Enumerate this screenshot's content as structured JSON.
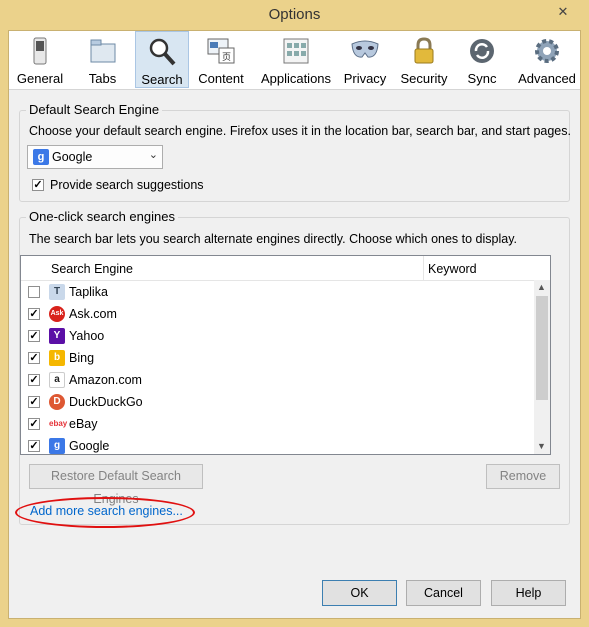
{
  "window": {
    "title": "Options",
    "close": "✕"
  },
  "toolbar": {
    "items": [
      {
        "label": "General",
        "icon": "general-switch-icon",
        "selected": false
      },
      {
        "label": "Tabs",
        "icon": "tabs-icon",
        "selected": false
      },
      {
        "label": "Search",
        "icon": "magnifier-icon",
        "selected": true
      },
      {
        "label": "Content",
        "icon": "content-icon",
        "selected": false
      },
      {
        "label": "Applications",
        "icon": "applications-icon",
        "selected": false
      },
      {
        "label": "Privacy",
        "icon": "mask-icon",
        "selected": false
      },
      {
        "label": "Security",
        "icon": "padlock-icon",
        "selected": false
      },
      {
        "label": "Sync",
        "icon": "sync-icon",
        "selected": false
      },
      {
        "label": "Advanced",
        "icon": "gear-icon",
        "selected": false
      }
    ]
  },
  "default_engine": {
    "legend": "Default Search Engine",
    "description": "Choose your default search engine. Firefox uses it in the location bar, search bar, and start pages.",
    "selected": "Google",
    "suggest_label": "Provide search suggestions",
    "suggest_checked": true
  },
  "one_click": {
    "legend": "One-click search engines",
    "description": "The search bar lets you search alternate engines directly. Choose which ones to display.",
    "columns": [
      "Search Engine",
      "Keyword"
    ],
    "engines": [
      {
        "name": "Taplika",
        "checked": false,
        "icon": "taplika-icon",
        "color": "#7fa3c9"
      },
      {
        "name": "Ask.com",
        "checked": true,
        "icon": "ask-icon",
        "color": "#d9231c"
      },
      {
        "name": "Yahoo",
        "checked": true,
        "icon": "yahoo-icon",
        "color": "#5b0fa6"
      },
      {
        "name": "Bing",
        "checked": true,
        "icon": "bing-icon",
        "color": "#f5b700"
      },
      {
        "name": "Amazon.com",
        "checked": true,
        "icon": "amazon-icon",
        "color": "#222222"
      },
      {
        "name": "DuckDuckGo",
        "checked": true,
        "icon": "duckduckgo-icon",
        "color": "#de5833"
      },
      {
        "name": "eBay",
        "checked": true,
        "icon": "ebay-icon",
        "color": "#e53238"
      },
      {
        "name": "Google",
        "checked": true,
        "icon": "google-icon",
        "color": "#3b78e7"
      }
    ],
    "restore_label": "Restore Default Search Engines",
    "remove_label": "Remove",
    "add_more_link": "Add more search engines..."
  },
  "buttons": {
    "ok": "OK",
    "cancel": "Cancel",
    "help": "Help"
  },
  "colors": {
    "selected_tab": "#d8e6f2",
    "link": "#0066cc",
    "annotation": "#e01010",
    "title_bar": "#ebd28b"
  }
}
